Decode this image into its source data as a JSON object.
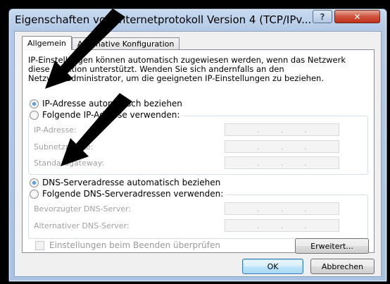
{
  "window": {
    "title": "Eigenschaften von Internetprotokoll Version 4 (TCP/IPv...",
    "help_label": "?",
    "close_label": "✕"
  },
  "tabs": [
    {
      "label": "Allgemein"
    },
    {
      "label": "Alternative Konfiguration"
    }
  ],
  "general": {
    "description": "IP-Einstellungen können automatisch zugewiesen werden, wenn das Netzwerk diese Funktion unterstützt. Wenden Sie sich andernfalls an den Netzwerkadministrator, um die geeigneten IP-Einstellungen zu beziehen.",
    "ip_auto_label": "IP-Adresse automatisch beziehen",
    "ip_manual_label": "Folgende IP-Adresse verwenden:",
    "ip_address_label": "IP-Adresse:",
    "subnet_label": "Subnetzmaske:",
    "gateway_label": "Standardgateway:",
    "dns_auto_label": "DNS-Serveradresse automatisch beziehen",
    "dns_manual_label": "Folgende DNS-Serveradressen verwenden:",
    "dns_preferred_label": "Bevorzugter DNS-Server:",
    "dns_alternate_label": "Alternativer DNS-Server:",
    "validate_label": "Einstellungen beim Beenden überprüfen",
    "advanced_button": "Erweitert..."
  },
  "ip_dots": ".",
  "footer": {
    "ok_button": "OK",
    "cancel_button": "Abbrechen"
  }
}
